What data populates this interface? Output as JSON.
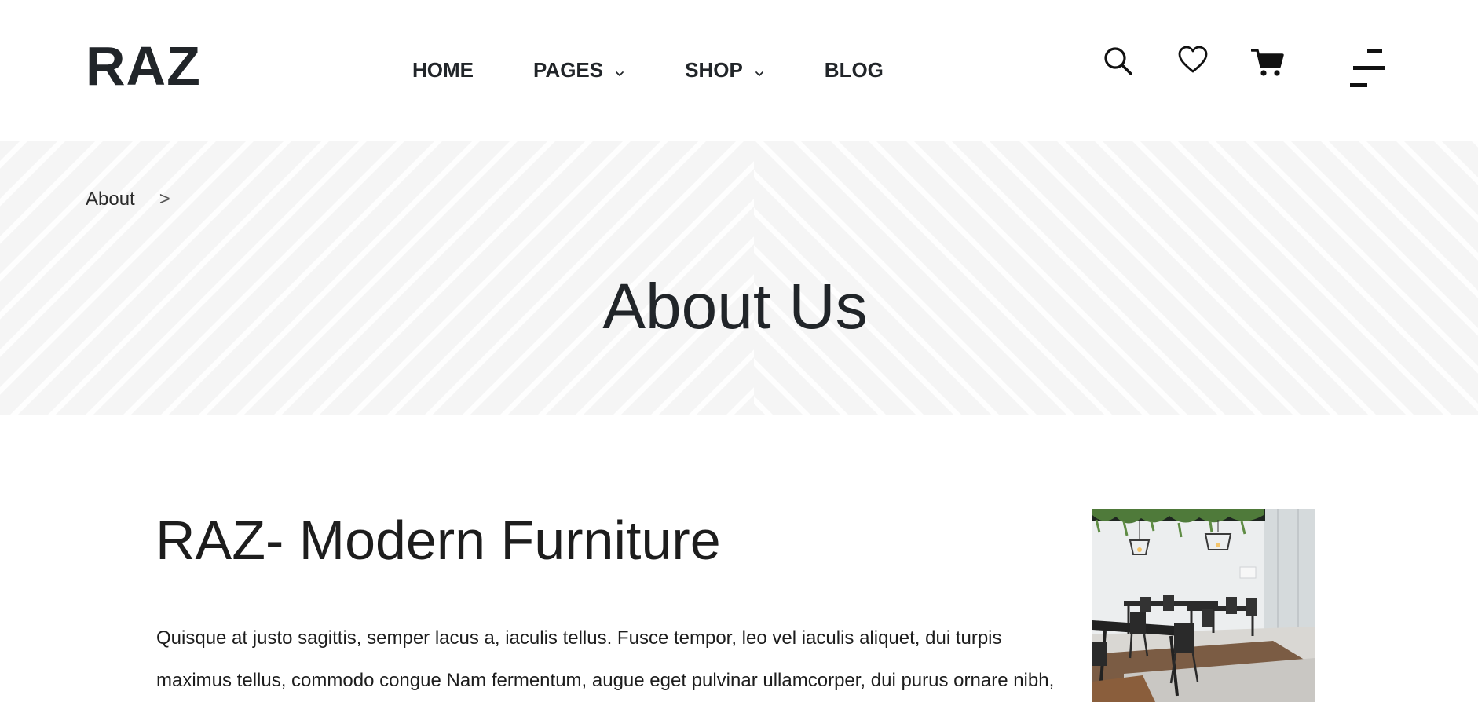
{
  "header": {
    "logo": "RAZ",
    "nav": [
      {
        "label": "HOME",
        "has_dropdown": false
      },
      {
        "label": "PAGES",
        "has_dropdown": true
      },
      {
        "label": "SHOP",
        "has_dropdown": true
      },
      {
        "label": "BLOG",
        "has_dropdown": false
      }
    ],
    "icons": [
      "search-icon",
      "heart-icon",
      "cart-icon",
      "menu-icon"
    ]
  },
  "banner": {
    "breadcrumb": {
      "current": "About",
      "separator": ">"
    },
    "title": "About Us"
  },
  "content": {
    "title": "RAZ- Modern Furniture",
    "paragraph": "Quisque at justo sagittis, semper lacus a, iaculis tellus. Fusce tempor, leo vel iaculis aliquet, dui turpis maximus tellus, commodo congue Nam fermentum, augue eget pulvinar ullamcorper, dui purus ornare nibh,"
  },
  "colors": {
    "text": "#212529",
    "banner_background": "#fefefe",
    "banner_stripes": "#f5f5f5"
  }
}
